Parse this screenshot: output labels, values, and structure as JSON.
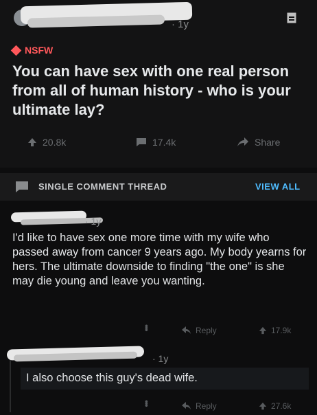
{
  "post": {
    "age": "· 1y",
    "nsfw_label": "NSFW",
    "title": "You can have sex with one real person from all of human history - who is your ultimate lay?",
    "upvotes": "20.8k",
    "comments": "17.4k",
    "share_label": "Share"
  },
  "thread": {
    "label": "SINGLE COMMENT THREAD",
    "view_all": "VIEW ALL"
  },
  "comments": [
    {
      "age": "· 1y",
      "body": "I'd like to have sex one more time with my wife who passed away from cancer 9 years ago. My body yearns for hers. The ultimate downside to finding \"the one\" is she may die young and leave you wanting.",
      "reply_label": "Reply",
      "votes": "17.9k"
    },
    {
      "age": "· 1y",
      "body": "I also choose this guy's dead wife.",
      "reply_label": "Reply",
      "votes": "27.6k"
    }
  ],
  "colors": {
    "accent_blue": "#4fbcff",
    "nsfw_red": "#ff585b",
    "background": "#0d0d0e"
  }
}
